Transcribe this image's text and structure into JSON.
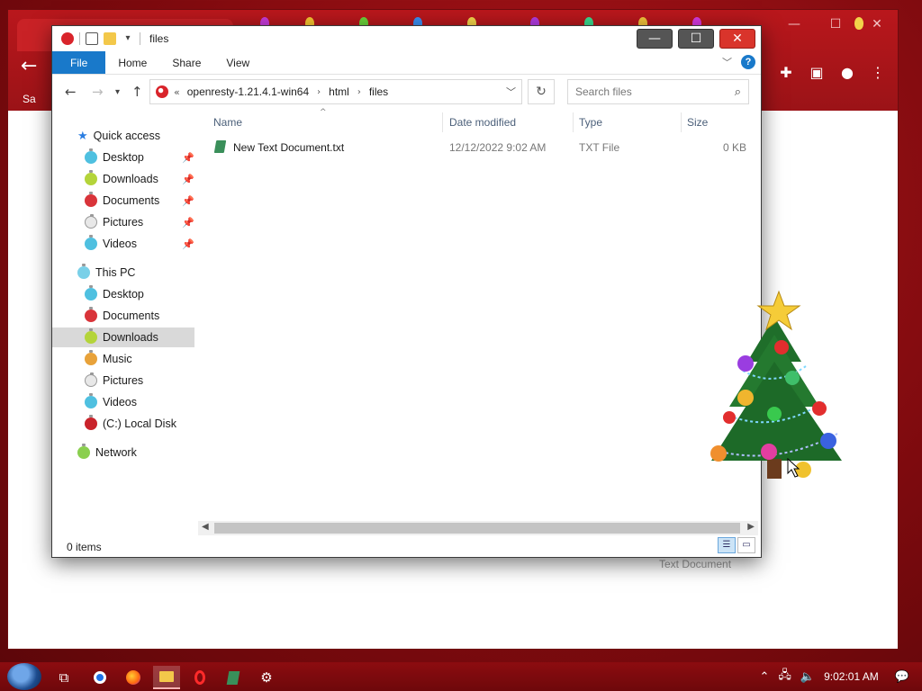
{
  "window": {
    "title": "files",
    "minimize": "—",
    "maximize": "☐",
    "close": "✕"
  },
  "ribbon": {
    "tabs": [
      "File",
      "Home",
      "Share",
      "View"
    ],
    "help": "?"
  },
  "address": {
    "overflow": "«",
    "crumbs": [
      "openresty-1.21.4.1-win64",
      "html",
      "files"
    ],
    "separator": "›"
  },
  "search": {
    "placeholder": "Search files"
  },
  "nav": {
    "quick_access": "Quick access",
    "quick_items": [
      "Desktop",
      "Downloads",
      "Documents",
      "Pictures",
      "Videos"
    ],
    "this_pc": "This PC",
    "pc_items": [
      "Desktop",
      "Documents",
      "Downloads",
      "Music",
      "Pictures",
      "Videos",
      "(C:) Local Disk"
    ],
    "network": "Network",
    "selected": "Downloads"
  },
  "columns": [
    "Name",
    "Date modified",
    "Type",
    "Size"
  ],
  "files": [
    {
      "name": "New Text Document.txt",
      "date": "12/12/2022 9:02 AM",
      "type": "TXT File",
      "size": "0 KB"
    }
  ],
  "status": {
    "items_text": "0 items"
  },
  "background": {
    "bookmark_fragment": "Sa",
    "ghost_label": "Text Document"
  },
  "taskbar": {
    "clock": "9:02:01 AM"
  },
  "colors": {
    "accent": "#1979ca",
    "taskbar": "#7d0a0e",
    "selection": "#d9d9d9"
  }
}
